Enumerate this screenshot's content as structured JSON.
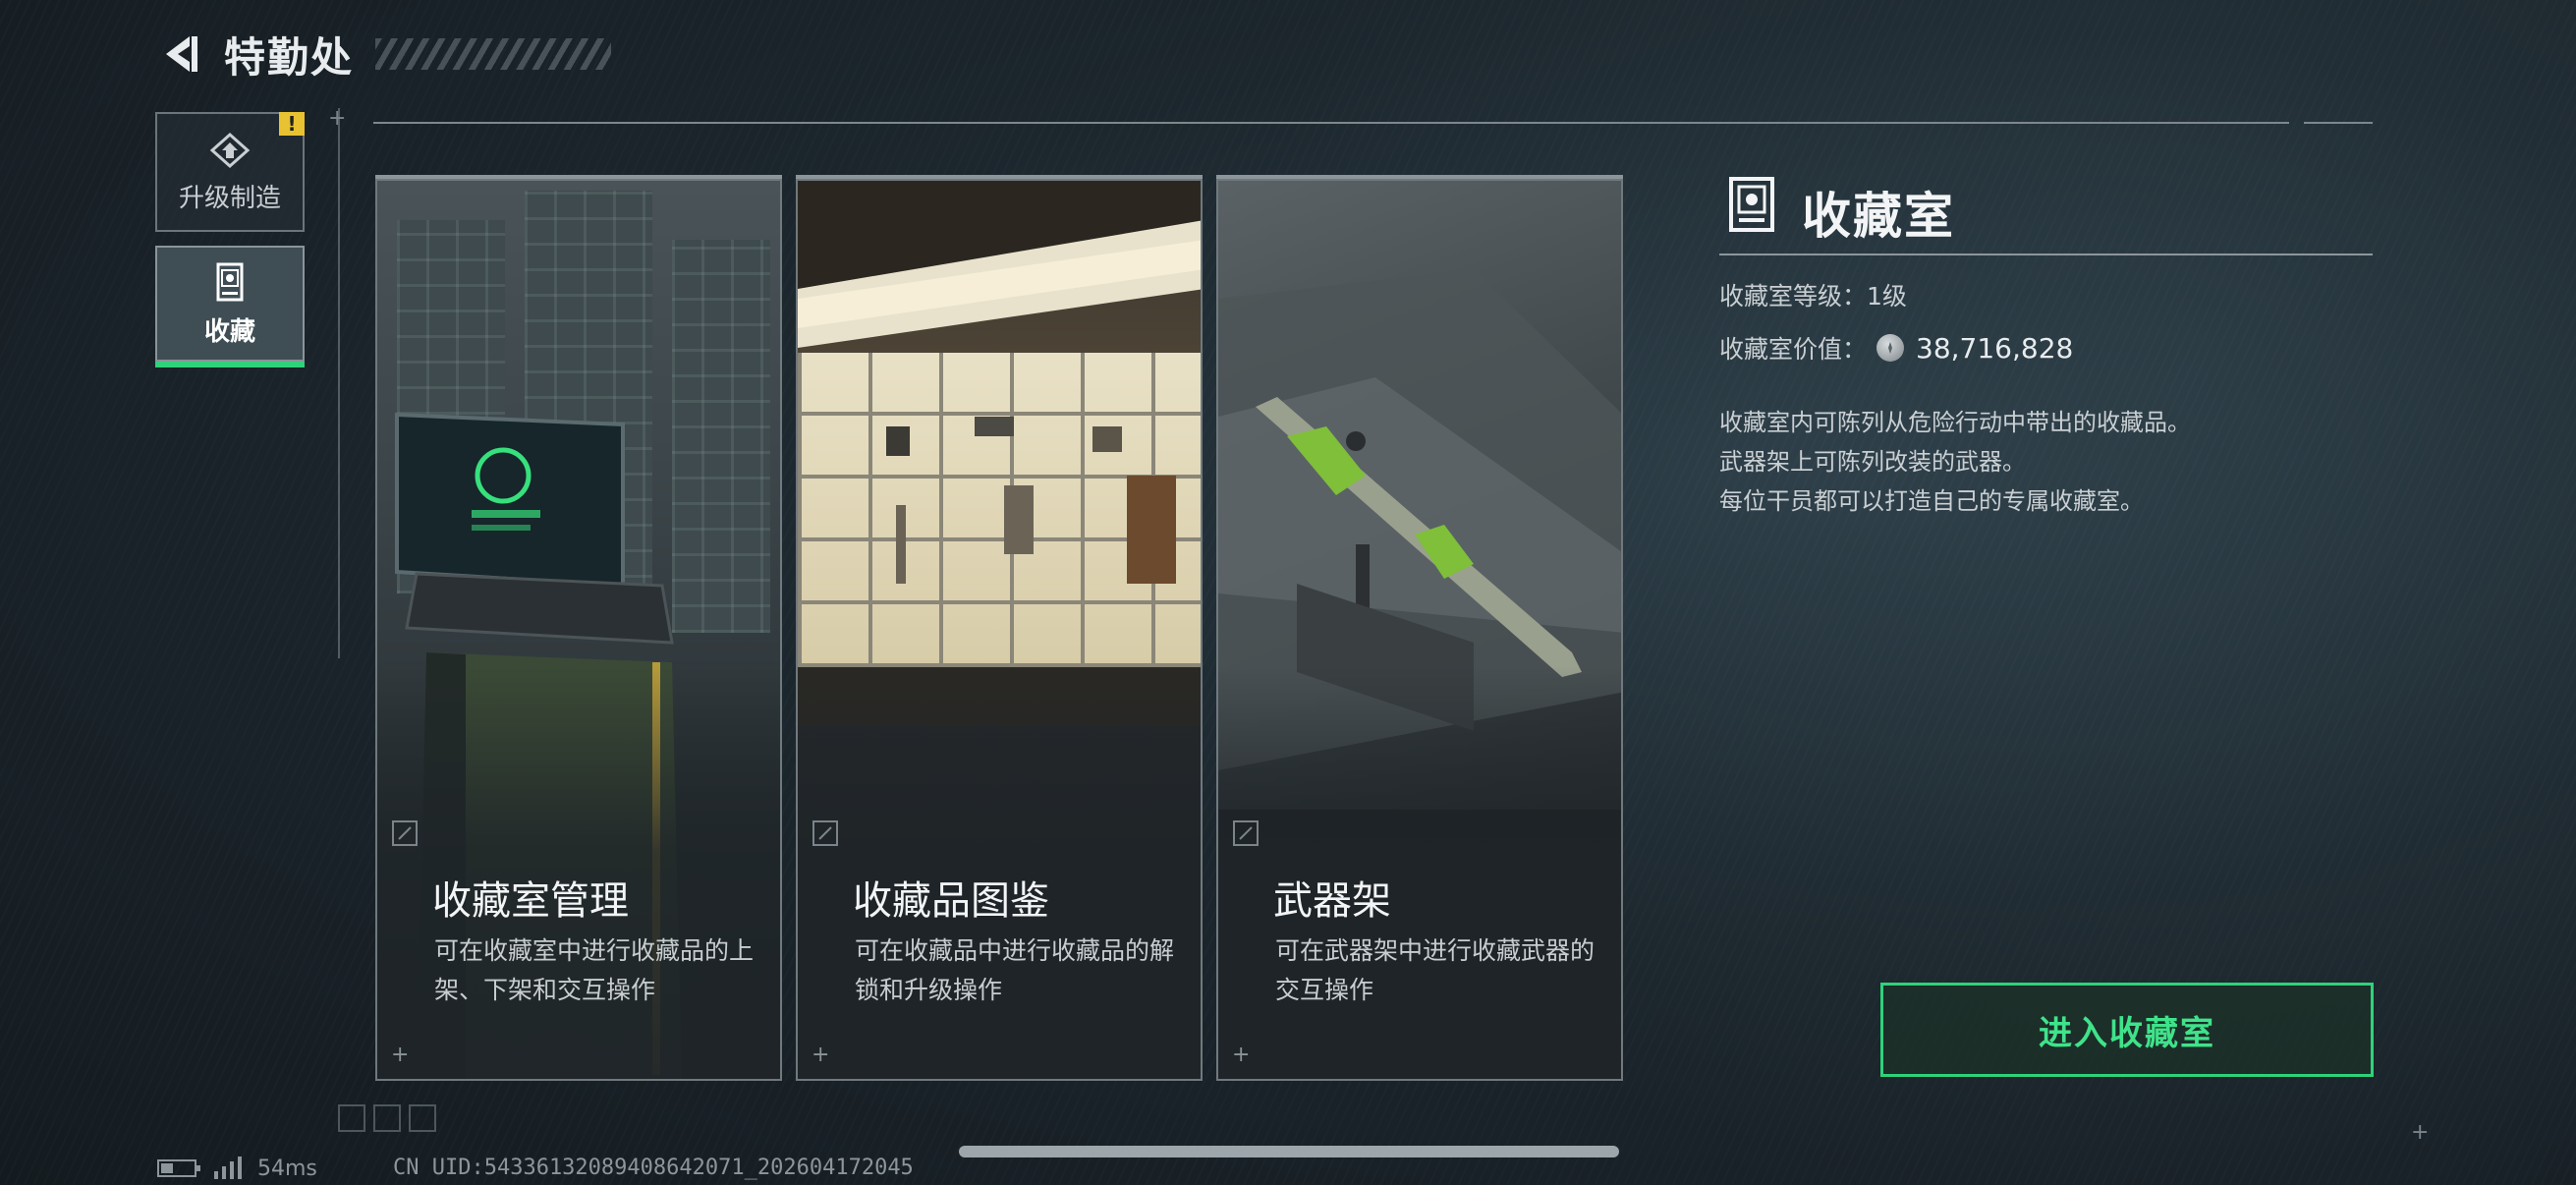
{
  "header": {
    "title": "特勤处"
  },
  "sidebar": {
    "items": [
      {
        "label": "升级制造",
        "badge": "!"
      },
      {
        "label": "收藏",
        "selected": true
      }
    ]
  },
  "cards": [
    {
      "title": "收藏室管理",
      "desc": "可在收藏室中进行收藏品的上架、下架和交互操作"
    },
    {
      "title": "收藏品图鉴",
      "desc": "可在收藏品中进行收藏品的解锁和升级操作"
    },
    {
      "title": "武器架",
      "desc": "可在武器架中进行收藏武器的交互操作"
    }
  ],
  "panel": {
    "title": "收藏室",
    "level": "收藏室等级：1级",
    "value_label": "收藏室价值：",
    "value": "38,716,828",
    "desc_lines": [
      "收藏室内可陈列从危险行动中带出的收藏品。",
      "武器架上可陈列改装的武器。",
      "每位干员都可以打造自己的专属收藏室。"
    ],
    "enter_button": "进入收藏室"
  },
  "footer": {
    "ping": "54ms",
    "uid": "CN UID:5433613208940864207​1_202604172045"
  },
  "colors": {
    "accent": "#2fd27a",
    "warning": "#e8c230"
  }
}
